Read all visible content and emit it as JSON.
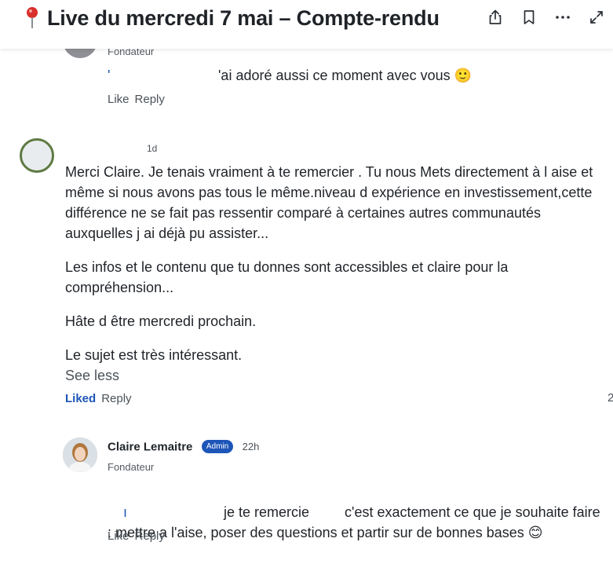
{
  "header": {
    "title": "Live du mercredi 7 mai – Compte-rendu",
    "icons": [
      "pin-icon",
      "share-icon",
      "bookmark-icon",
      "more-icon",
      "expand-icon"
    ]
  },
  "comment1": {
    "role": "Fondateur",
    "text": "'ai adoré aussi ce moment avec vous 🙂",
    "like_label": "Like",
    "reply_label": "Reply"
  },
  "comment2": {
    "time": "1d",
    "paragraphs": [
      "Merci Claire.  Je tenais vraiment à te remercier . Tu nous Mets directement à l aise et  même si nous  avons pas tous le même.niveau d expérience en investissement,cette différence ne se fait pas ressentir comparé à certaines autres communautés auxquelles j ai déjà pu assister...",
      "Les infos et le contenu que tu donnes sont accessibles et claire pour la compréhension...",
      "Hâte d être mercredi prochain.",
      "Le sujet est très intéressant."
    ],
    "see_less": "See less",
    "liked_label": "Liked",
    "reply_label": "Reply",
    "edge_count": "2"
  },
  "comment3": {
    "author": "Claire Lemaitre",
    "badge": "Admin",
    "time": "22h",
    "role": "Fondateur",
    "text": "je te remercie         c'est exactement ce que je souhaite faire : mettre a l'aise, poser des questions et partir sur de bonnes bases 😊",
    "like_label": "Like",
    "reply_label": "Reply"
  },
  "colors": {
    "accent": "#1d56b8",
    "text": "#1f2328",
    "muted": "#4b5259"
  }
}
